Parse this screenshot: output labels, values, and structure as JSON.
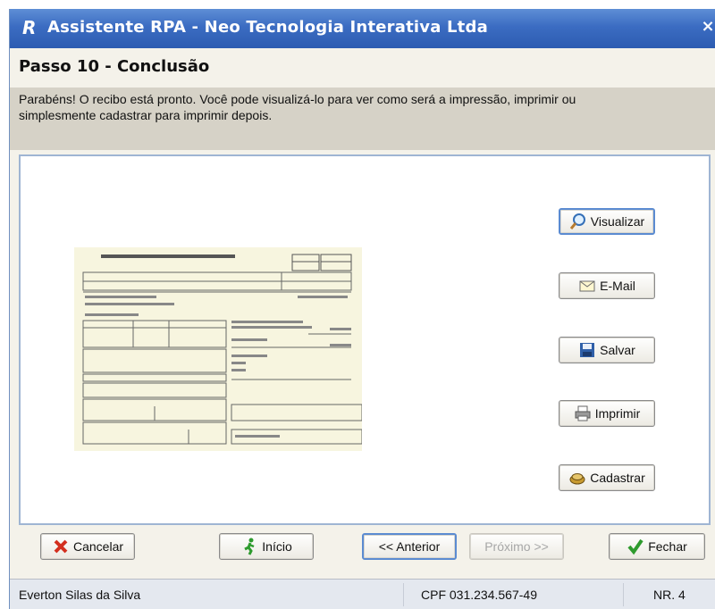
{
  "window": {
    "title": "Assistente RPA - Neo Tecnologia Interativa Ltda",
    "close_label": "×"
  },
  "step": {
    "title": "Passo 10 - Conclusão",
    "description_line1": "Parabéns! O recibo está pronto. Você pode visualizá-lo para ver como será a impressão, imprimir ou",
    "description_line2": "simplesmente cadastrar para imprimir depois."
  },
  "actions": {
    "visualizar": "Visualizar",
    "email": "E-Mail",
    "salvar": "Salvar",
    "imprimir": "Imprimir",
    "cadastrar": "Cadastrar"
  },
  "nav": {
    "cancelar": "Cancelar",
    "inicio": "Início",
    "anterior": "<< Anterior",
    "proximo": "Próximo >>",
    "fechar": "Fechar"
  },
  "status": {
    "user": "Everton Silas da Silva",
    "cpf": "CPF 031.234.567-49",
    "nr": "NR. 4"
  },
  "colors": {
    "titlebar": "#3b6cc2",
    "description_band": "#d6d2c7",
    "content_border": "#9fb5d3",
    "cancel_icon": "#d32f1f",
    "fechar_icon": "#2e9b2e"
  }
}
